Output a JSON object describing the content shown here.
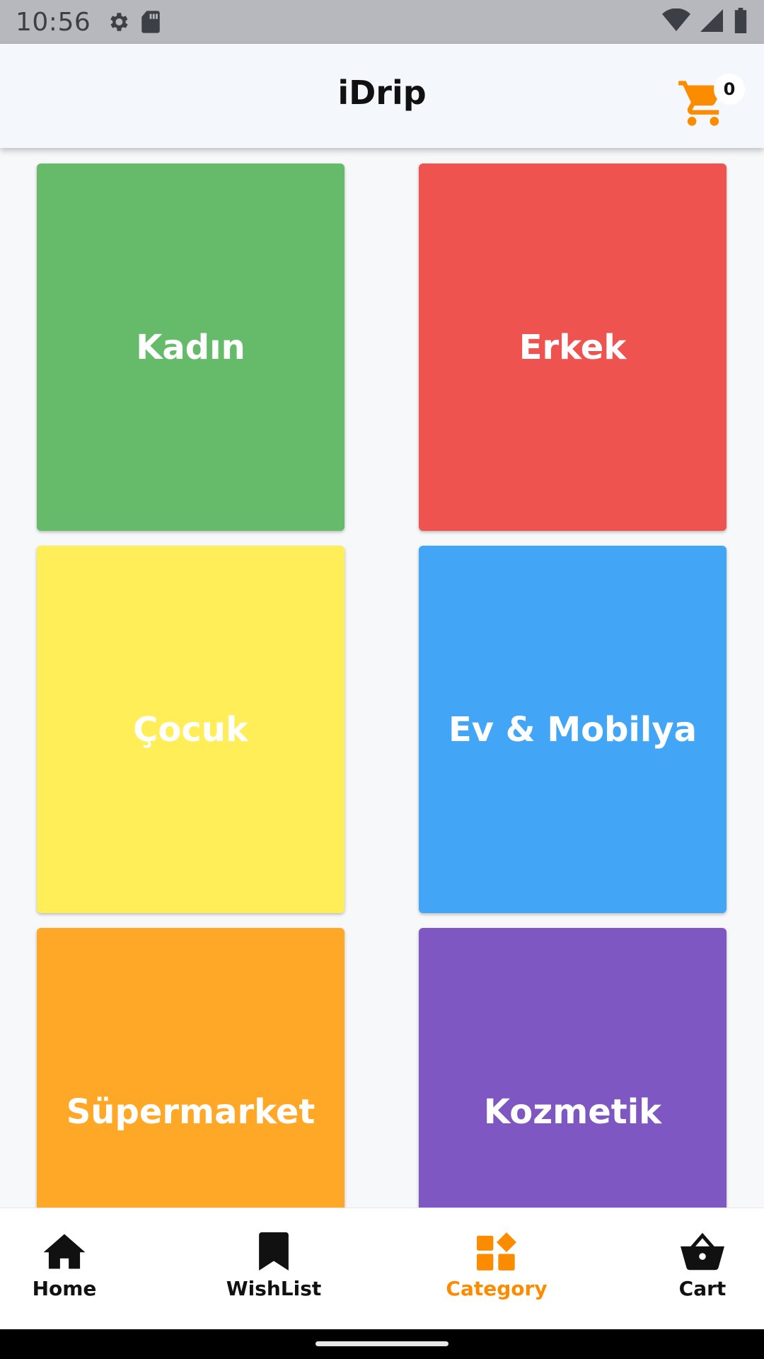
{
  "status_bar": {
    "time": "10:56",
    "icons": [
      "settings-icon",
      "sd-card-icon",
      "wifi-icon",
      "signal-icon",
      "battery-icon"
    ]
  },
  "app_bar": {
    "title": "iDrip",
    "cart_count": "0",
    "cart_icon_color": "#fb8c00"
  },
  "categories": [
    {
      "label": "Kadın",
      "color": "#66bb6a"
    },
    {
      "label": "Erkek",
      "color": "#ef5350"
    },
    {
      "label": "Çocuk",
      "color": "#ffee58"
    },
    {
      "label": "Ev & Mobilya",
      "color": "#42a5f5"
    },
    {
      "label": "Süpermarket",
      "color": "#ffa726"
    },
    {
      "label": "Kozmetik",
      "color": "#7e57c2"
    }
  ],
  "bottom_nav": {
    "active_color": "#fb8c00",
    "items": [
      {
        "label": "Home",
        "icon": "home-icon",
        "active": false
      },
      {
        "label": "WishList",
        "icon": "bookmark-icon",
        "active": false
      },
      {
        "label": "Category",
        "icon": "category-icon",
        "active": true
      },
      {
        "label": "Cart",
        "icon": "basket-icon",
        "active": false
      }
    ]
  }
}
